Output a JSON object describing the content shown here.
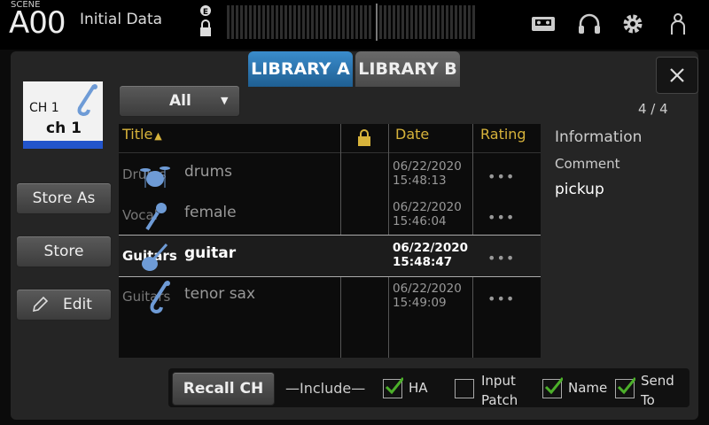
{
  "scene": {
    "label": "SCENE",
    "number": "A00",
    "name": "Initial Data"
  },
  "top_icons": [
    "cassette-icon",
    "headphones-icon",
    "gear-icon",
    "user-icon"
  ],
  "tabs": [
    {
      "label": "LIBRARY A",
      "active": true
    },
    {
      "label": "LIBRARY B",
      "active": false
    }
  ],
  "channel": {
    "label": "CH 1",
    "name": "ch 1",
    "icon": "saxophone-icon",
    "color": "#2255cc"
  },
  "filter": {
    "selected": "All"
  },
  "count": "4 / 4",
  "buttons": {
    "store_as": "Store As",
    "store": "Store",
    "edit": "Edit"
  },
  "columns": {
    "title": "Title",
    "date": "Date",
    "rating": "Rating"
  },
  "rows": [
    {
      "category": "Drums",
      "icon": "drums-icon",
      "title": "drums",
      "date": "06/22/2020",
      "time": "15:48:13",
      "rating": "•••",
      "selected": false
    },
    {
      "category": "Vocal",
      "icon": "microphone-icon",
      "title": "female",
      "date": "06/22/2020",
      "time": "15:46:04",
      "rating": "•••",
      "selected": false
    },
    {
      "category": "Guitars",
      "icon": "guitar-icon",
      "title": "guitar",
      "date": "06/22/2020",
      "time": "15:48:47",
      "rating": "•••",
      "selected": true
    },
    {
      "category": "Guitars",
      "icon": "saxophone-icon",
      "title": "tenor sax",
      "date": "06/22/2020",
      "time": "15:49:09",
      "rating": "•••",
      "selected": false
    }
  ],
  "info": {
    "heading": "Information",
    "comment_label": "Comment",
    "comment": "pickup"
  },
  "recall": {
    "label": "Recall CH",
    "include_label": "Include"
  },
  "include_options": [
    {
      "label": "HA",
      "checked": true
    },
    {
      "label1": "Input",
      "label2": "Patch",
      "checked": false
    },
    {
      "label": "Name",
      "checked": true
    },
    {
      "label1": "Send",
      "label2": "To",
      "checked": true
    }
  ],
  "colors": {
    "accent_tab": "#2a7ab8",
    "header_text": "#d7b33b",
    "check": "#4caf2a"
  }
}
